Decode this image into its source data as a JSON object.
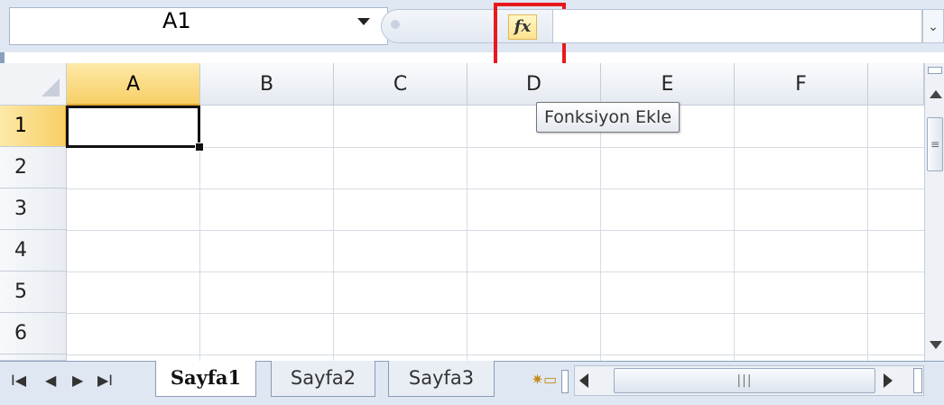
{
  "formula_bar": {
    "name_box_value": "A1",
    "fx_label": "fx",
    "formula_value": ""
  },
  "tooltip": {
    "text": "Fonksiyon Ekle"
  },
  "columns": [
    "A",
    "B",
    "C",
    "D",
    "E",
    "F"
  ],
  "rows": [
    "1",
    "2",
    "3",
    "4",
    "5",
    "6"
  ],
  "active_cell": "A1",
  "sheet_tabs": [
    "Sayfa1",
    "Sayfa2",
    "Sayfa3"
  ],
  "active_sheet": "Sayfa1",
  "nav_glyphs": {
    "first": "I◀",
    "prev": "◀",
    "next": "▶",
    "last": "▶I"
  },
  "colors": {
    "highlight_box": "#e8191d",
    "selected_header": "#f8cf66",
    "accent": "#dfe7f2"
  }
}
